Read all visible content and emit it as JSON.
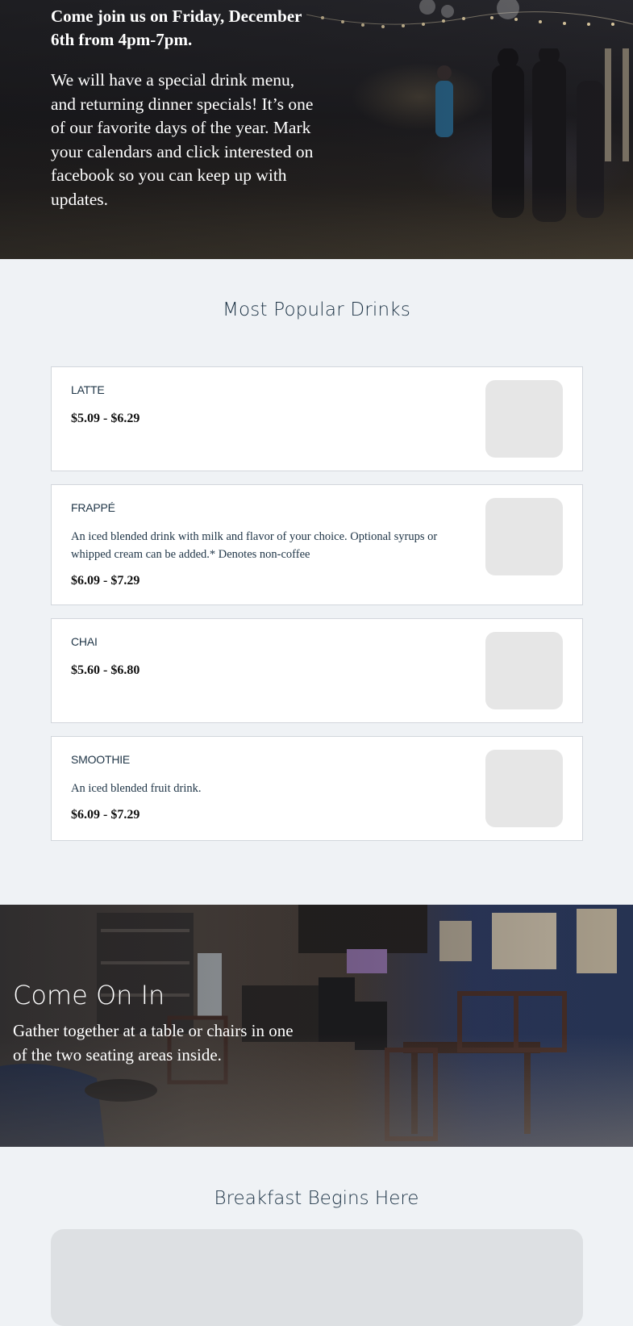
{
  "event": {
    "headline": "Come join us on Friday, December 6th from 4pm-7pm.",
    "body": "We will have a special drink menu, and returning dinner specials! It’s one of our favorite days of the year. Mark your calendars and click interested on facebook so you can keep up with updates."
  },
  "popular_drinks": {
    "title": "Most Popular Drinks",
    "items": [
      {
        "name": "LATTE",
        "description": "",
        "price": "$5.09 - $6.29"
      },
      {
        "name": "FRAPPÉ",
        "description": "An iced blended drink with milk and flavor of your choice. Optional syrups or whipped cream can be added.* Denotes non-coffee",
        "price": "$6.09 - $7.29"
      },
      {
        "name": "CHAI",
        "description": "",
        "price": "$5.60 - $6.80"
      },
      {
        "name": "SMOOTHIE",
        "description": "An iced blended fruit drink.",
        "price": "$6.09 - $7.29"
      }
    ]
  },
  "come_on_in": {
    "title": "Come On In",
    "body": "Gather together at a table or chairs in one of the two seating areas inside."
  },
  "breakfast": {
    "title": "Breakfast Begins Here"
  }
}
